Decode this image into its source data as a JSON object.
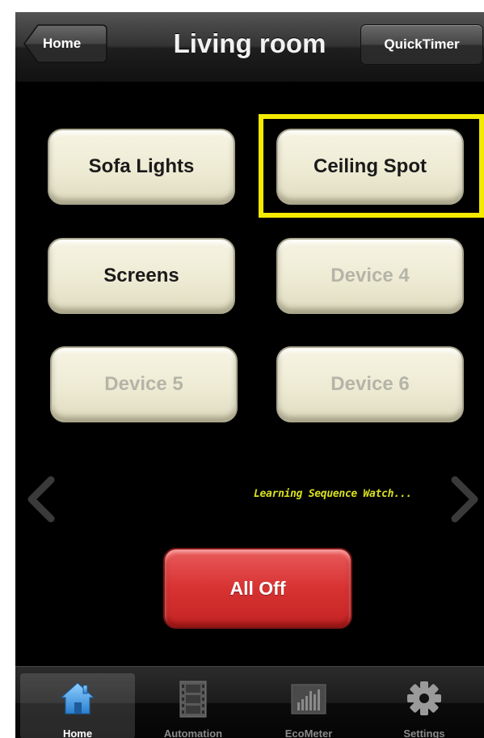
{
  "navbar": {
    "title": "Living room",
    "back_label": "Home",
    "right_label": "QuickTimer"
  },
  "devices": [
    {
      "label": "Sofa Lights",
      "state": "on"
    },
    {
      "label": "Ceiling Spot",
      "state": "on",
      "highlighted": true
    },
    {
      "label": "Screens",
      "state": "on"
    },
    {
      "label": "Device 4",
      "state": "disabled"
    },
    {
      "label": "Device 5",
      "state": "disabled"
    },
    {
      "label": "Device 6",
      "state": "disabled"
    }
  ],
  "status_text": "Learning Sequence Watch...",
  "all_off_label": "All Off",
  "tabs": [
    {
      "label": "Home",
      "icon": "house-icon",
      "active": true
    },
    {
      "label": "Automation",
      "icon": "film-strip-icon"
    },
    {
      "label": "EcoMeter",
      "icon": "meter-bars-icon"
    },
    {
      "label": "Settings",
      "icon": "gear-icon"
    }
  ],
  "colors": {
    "highlight": "#f4ea00",
    "all_off": "#d83232",
    "status_text": "#d8e020",
    "device_face": "#efecd6"
  }
}
